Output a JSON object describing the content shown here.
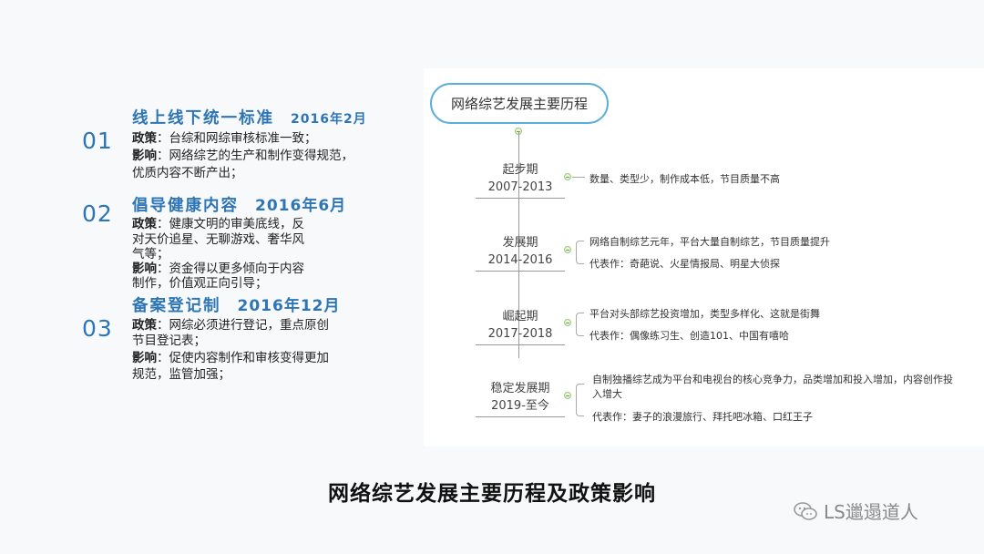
{
  "policies": [
    {
      "num": "01",
      "title": "线上线下统一标准",
      "date": "2016年2月",
      "lines": [
        [
          "政策",
          "：台综和网综审核标准一致；"
        ],
        [
          "影响",
          "：网络综艺的生产和制作变得规范，"
        ],
        [
          "",
          "优质内容不断产出；"
        ]
      ]
    },
    {
      "num": "02",
      "title": "倡导健康内容",
      "date": "2016年6月",
      "lines": [
        [
          "政策",
          "：健康文明的审美底线，反"
        ],
        [
          "",
          "对天价追星、无聊游戏、奢华风"
        ],
        [
          "",
          "气等；"
        ],
        [
          "影响",
          "：资金得以更多倾向于内容"
        ],
        [
          "",
          "制作，价值观正向引导；"
        ]
      ]
    },
    {
      "num": "03",
      "title": "备案登记制",
      "date": "2016年12月",
      "lines": [
        [
          "政策",
          "：网综必须进行登记，重点原创"
        ],
        [
          "",
          "节目登记表；"
        ],
        [
          "影响",
          "：促使内容制作和审核变得更加"
        ],
        [
          "",
          "规范，监管加强；"
        ]
      ]
    }
  ],
  "mindmap": {
    "root": "网络综艺发展主要历程",
    "phases": [
      {
        "name": "起步期",
        "years": "2007-2013",
        "items": [
          "数量、类型少，制作成本低，节目质量不高"
        ]
      },
      {
        "name": "发展期",
        "years": "2014-2016",
        "items": [
          "网络自制综艺元年，平台大量自制综艺，节目质量提升",
          "代表作：奇葩说、火星情报局、明星大侦探"
        ]
      },
      {
        "name": "崛起期",
        "years": "2017-2018",
        "items": [
          "平台对头部综艺投资增加，类型多样化、这就是街舞",
          "代表作：偶像练习生、创造101、中国有嘻哈"
        ]
      },
      {
        "name": "稳定发展期",
        "years": "2019-至今",
        "items": [
          "自制独播综艺成为平台和电视台的核心竞争力，品类增加和投入增加，内容创作投",
          "入增大",
          "代表作：妻子的浪漫旅行、拜托吧冰箱、口红王子"
        ]
      }
    ]
  },
  "caption": "网络综艺发展主要历程及政策影响",
  "watermark": {
    "text": "LS邋遢道人",
    "icon": "wechat-icon"
  }
}
